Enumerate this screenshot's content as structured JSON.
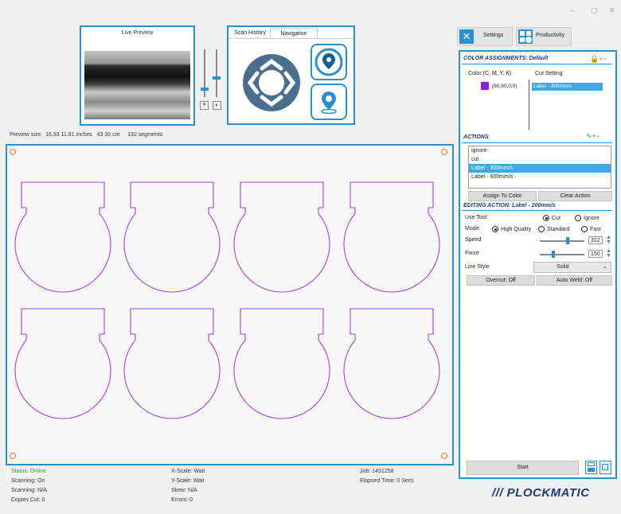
{
  "window": {
    "minimize": "–",
    "maximize": "▢",
    "close": "✕"
  },
  "live_preview": {
    "title": "Live Preview"
  },
  "tabs": [
    {
      "label": "Scan History"
    },
    {
      "label": "Navigation"
    }
  ],
  "preview_info": {
    "size_label": "Preview size",
    "inches": "16.93  11.81 inches",
    "cm": "43  30 cm",
    "segments": "132 segments"
  },
  "toolbar": {
    "settings": "Settings",
    "productivity": "Productivity"
  },
  "color_assignments": {
    "title": "COLOR ASSIGNMENTS: Default",
    "col_color": "Color (C, M, Y, K)",
    "col_cut": "Cut Setting",
    "rows": [
      {
        "swatch": "#8b1fe0",
        "cmyk": "(60,90,0,0)",
        "setting": "Label - 300mm/s"
      }
    ]
  },
  "actions": {
    "title": "ACTIONS",
    "items": [
      "ignore",
      "cut",
      "Label - 300mm/s",
      "Label - 600mm/s"
    ],
    "selected_index": 2,
    "assign_btn": "Assign To Color",
    "clear_btn": "Clear Action"
  },
  "editing": {
    "title": "EDITING ACTION: Label - 200mm/s",
    "use_tool_label": "Use Tool:",
    "tool_cut": "Cut",
    "tool_ignore": "Ignore",
    "mode_label": "Mode:",
    "mode_hq": "High Quality",
    "mode_standard": "Standard",
    "mode_fast": "Fast",
    "speed_label": "Speed",
    "speed_value": "312",
    "speed_fraction": 0.62,
    "force_label": "Force",
    "force_value": "150",
    "force_fraction": 0.3,
    "line_style_label": "Line Style",
    "line_style_value": "Solid",
    "overcut": "Overcut: Off",
    "autoweld": "Auto Weld: Off"
  },
  "start_btn": "Start",
  "brand": "/// PLOCKMATIC",
  "status": {
    "online": "Status: Online",
    "scanning": "Scanning: On",
    "scanning2": "Scanning:  N/A",
    "copies": "Copies Cut: 0",
    "xscale": "X-Scale: Wait",
    "yscale": "Y-Scale: Wait",
    "skew": "Skew:  N/A",
    "errors": "Errors: 0",
    "job": "Job: 1451258",
    "elapsed": "Elapsed Time:  0 Secs"
  },
  "colors": {
    "accent": "#2a8fd0",
    "cut_line": "#a040e8",
    "online": "#2aa52a",
    "nav": "#4a6f8e"
  },
  "icons": {
    "settings": "wrench-screwdriver-icon",
    "productivity": "dashboard-icon",
    "nav": "direction-pad-icon",
    "save": "save-icon"
  }
}
